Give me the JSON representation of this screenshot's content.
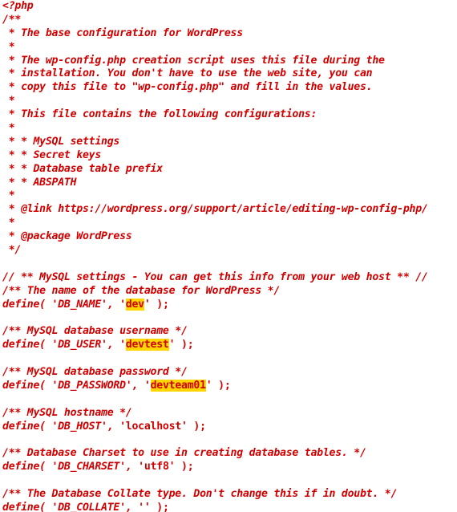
{
  "code": {
    "lines": [
      {
        "kind": "comment",
        "text": "<?php"
      },
      {
        "kind": "comment",
        "text": "/**"
      },
      {
        "kind": "comment",
        "text": " * The base configuration for WordPress"
      },
      {
        "kind": "comment",
        "text": " *"
      },
      {
        "kind": "comment",
        "text": " * The wp-config.php creation script uses this file during the"
      },
      {
        "kind": "comment",
        "text": " * installation. You don't have to use the web site, you can"
      },
      {
        "kind": "comment",
        "text": " * copy this file to \"wp-config.php\" and fill in the values."
      },
      {
        "kind": "comment",
        "text": " *"
      },
      {
        "kind": "comment",
        "text": " * This file contains the following configurations:"
      },
      {
        "kind": "comment",
        "text": " *"
      },
      {
        "kind": "comment",
        "text": " * * MySQL settings"
      },
      {
        "kind": "comment",
        "text": " * * Secret keys"
      },
      {
        "kind": "comment",
        "text": " * * Database table prefix"
      },
      {
        "kind": "comment",
        "text": " * * ABSPATH"
      },
      {
        "kind": "comment",
        "text": " *"
      },
      {
        "kind": "comment",
        "text": " * @link https://wordpress.org/support/article/editing-wp-config-php/"
      },
      {
        "kind": "comment",
        "text": " *"
      },
      {
        "kind": "comment",
        "text": " * @package WordPress"
      },
      {
        "kind": "comment",
        "text": " */"
      },
      {
        "kind": "blank",
        "text": ""
      },
      {
        "kind": "comment",
        "text": "// ** MySQL settings - You can get this info from your web host ** //"
      },
      {
        "kind": "comment",
        "text": "/** The name of the database for WordPress */"
      },
      {
        "kind": "define",
        "prefix": "define( 'DB_NAME', '",
        "value": "dev",
        "suffix": "' );",
        "highlight": true
      },
      {
        "kind": "blank",
        "text": ""
      },
      {
        "kind": "comment",
        "text": "/** MySQL database username */"
      },
      {
        "kind": "define",
        "prefix": "define( 'DB_USER', '",
        "value": "devtest",
        "suffix": "' );",
        "highlight": true
      },
      {
        "kind": "blank",
        "text": ""
      },
      {
        "kind": "comment",
        "text": "/** MySQL database password */"
      },
      {
        "kind": "define",
        "prefix": "define( 'DB_PASSWORD', '",
        "value": "devteam01",
        "suffix": "' );",
        "highlight": true
      },
      {
        "kind": "blank",
        "text": ""
      },
      {
        "kind": "comment",
        "text": "/** MySQL hostname */"
      },
      {
        "kind": "define",
        "prefix": "define( 'DB_HOST', '",
        "value": "localhost",
        "suffix": "' );",
        "highlight": false
      },
      {
        "kind": "blank",
        "text": ""
      },
      {
        "kind": "comment",
        "text": "/** Database Charset to use in creating database tables. */"
      },
      {
        "kind": "define",
        "prefix": "define( 'DB_CHARSET', '",
        "value": "utf8",
        "suffix": "' );",
        "highlight": false
      },
      {
        "kind": "blank",
        "text": ""
      },
      {
        "kind": "comment",
        "text": "/** The Database Collate type. Don't change this if in doubt. */"
      },
      {
        "kind": "define",
        "prefix": "define( 'DB_COLLATE', '",
        "value": "",
        "suffix": "' );",
        "highlight": false
      }
    ]
  },
  "colors": {
    "text": "#d10000",
    "highlight": "#ffd600",
    "background": "#ffffff"
  }
}
